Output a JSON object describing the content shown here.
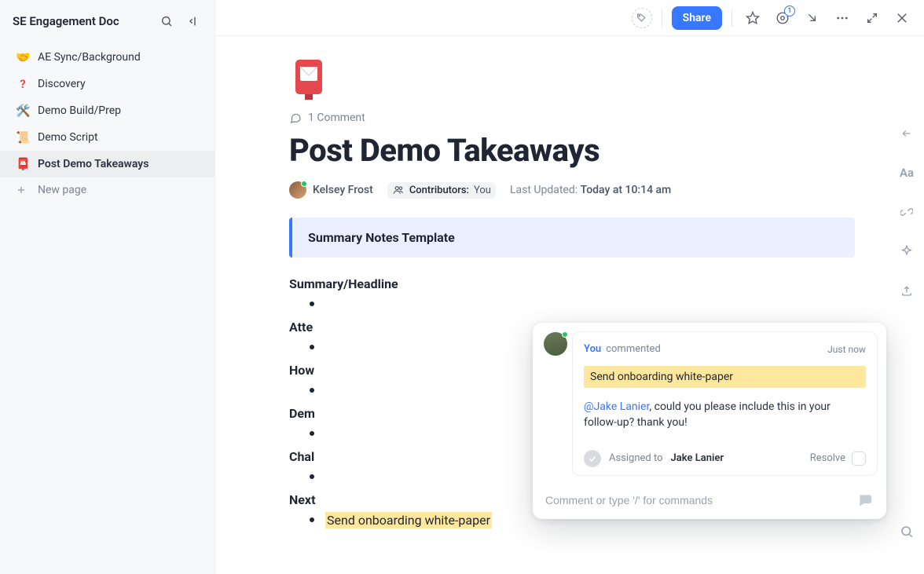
{
  "sidebar": {
    "title": "SE Engagement Doc",
    "items": [
      {
        "emoji": "🤝",
        "label": "AE Sync/Background"
      },
      {
        "emoji": "❓",
        "label": "Discovery"
      },
      {
        "emoji": "🛠️",
        "label": "Demo Build/Prep"
      },
      {
        "emoji": "📜",
        "label": "Demo Script"
      },
      {
        "emoji": "📮",
        "label": "Post Demo Takeaways"
      }
    ],
    "new_page_label": "New page"
  },
  "topbar": {
    "share_label": "Share",
    "notification_count": "1"
  },
  "doc": {
    "comment_count_label": "1 Comment",
    "title": "Post Demo Takeaways",
    "author_name": "Kelsey Frost",
    "contributors_label": "Contributors:",
    "contributors_value": "You",
    "updated_label": "Last Updated:",
    "updated_value": "Today at 10:14 am",
    "callout": "Summary Notes Template",
    "sections": {
      "s0": "Summary/Headline",
      "s1": "Atte",
      "s2": "How",
      "s3": "Dem",
      "s4": "Chal",
      "s5": "Next"
    },
    "next_bullet": "Send onboarding white-paper"
  },
  "comment": {
    "you_label": "You",
    "action": "commented",
    "when": "Just now",
    "quote": "Send onboarding white-paper",
    "mention": "@Jake Lanier",
    "body_rest": ", could you please include this in your follow-up? thank you!",
    "assigned_to_label": "Assigned to",
    "assignee": "Jake Lanier",
    "resolve_label": "Resolve",
    "input_placeholder": "Comment or type '/' for commands"
  }
}
